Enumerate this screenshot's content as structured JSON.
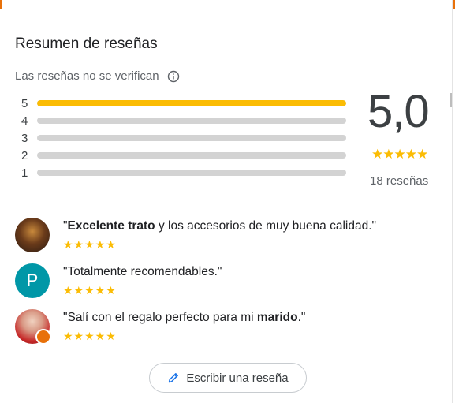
{
  "summary": {
    "title": "Resumen de reseñas",
    "subtitle": "Las reseñas no se verifican",
    "info_icon": "info-icon",
    "average": "5,0",
    "average_stars": "★★★★★",
    "total_label": "18 reseñas",
    "distribution": [
      {
        "label": "5",
        "fraction": 1.0
      },
      {
        "label": "4",
        "fraction": 0.0
      },
      {
        "label": "3",
        "fraction": 0.0
      },
      {
        "label": "2",
        "fraction": 0.0
      },
      {
        "label": "1",
        "fraction": 0.0
      }
    ],
    "colors": {
      "star": "#fbbc04",
      "track": "#d3d3d3"
    }
  },
  "reviews": [
    {
      "avatar": "photo",
      "open_quote": "\"",
      "bold1": "Excelente trato",
      "rest1": " y los accesorios de muy buena calidad.\"",
      "stars": "★★★★★"
    },
    {
      "avatar": "letter",
      "avatar_letter": "P",
      "text": "\"Totalmente recomendables.\"",
      "stars": "★★★★★"
    },
    {
      "avatar": "photo",
      "pre": "\"Salí con el regalo perfecto para mi ",
      "bold": "marido",
      "post": ".\"",
      "stars": "★★★★★"
    }
  ],
  "write_button": {
    "label": "Escribir una reseña",
    "icon": "pencil-icon"
  }
}
